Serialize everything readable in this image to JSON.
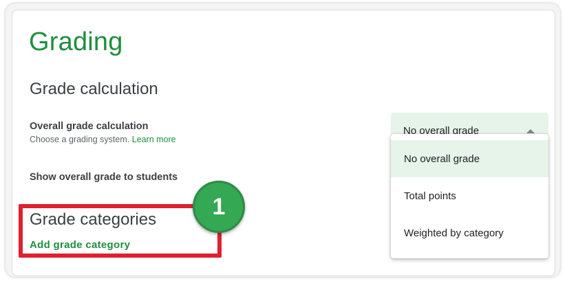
{
  "page": {
    "title": "Grading"
  },
  "grade_calculation": {
    "section_title": "Grade calculation",
    "overall_label": "Overall grade calculation",
    "overall_help": "Choose a grading system.",
    "learn_more": "Learn more",
    "show_label": "Show overall grade to students",
    "select": {
      "selected_value": "No overall grade",
      "options": [
        "No overall grade",
        "Total points",
        "Weighted by category"
      ]
    }
  },
  "grade_categories": {
    "section_title": "Grade categories",
    "add_link": "Add grade category"
  },
  "annotation": {
    "step_number": "1"
  },
  "colors": {
    "accent_green": "#1e8e3e",
    "selected_bg": "#e6f4ea",
    "highlight_red": "#e0202e",
    "badge_green": "#34a853"
  }
}
